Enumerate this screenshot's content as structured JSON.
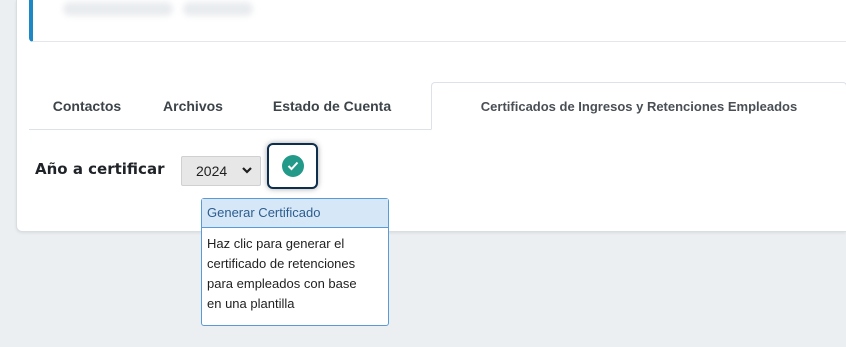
{
  "tabs": [
    {
      "label": "Contactos",
      "active": false
    },
    {
      "label": "Archivos",
      "active": false
    },
    {
      "label": "Estado de Cuenta",
      "active": false
    },
    {
      "label": "Certificados de Ingresos y Retenciones Empleados",
      "active": true
    }
  ],
  "form": {
    "year_label": "Año a certificar",
    "year_value": "2024",
    "confirm_icon": "check-circle-icon"
  },
  "tooltip": {
    "title": "Generar Certificado",
    "lines": [
      "Haz clic para generar el",
      "certificado de retenciones",
      "para empleados con base",
      "en una plantilla"
    ]
  },
  "colors": {
    "accent": "#1e88c7",
    "confirm": "#239a89",
    "tooltip_border": "#5b9bd5"
  }
}
